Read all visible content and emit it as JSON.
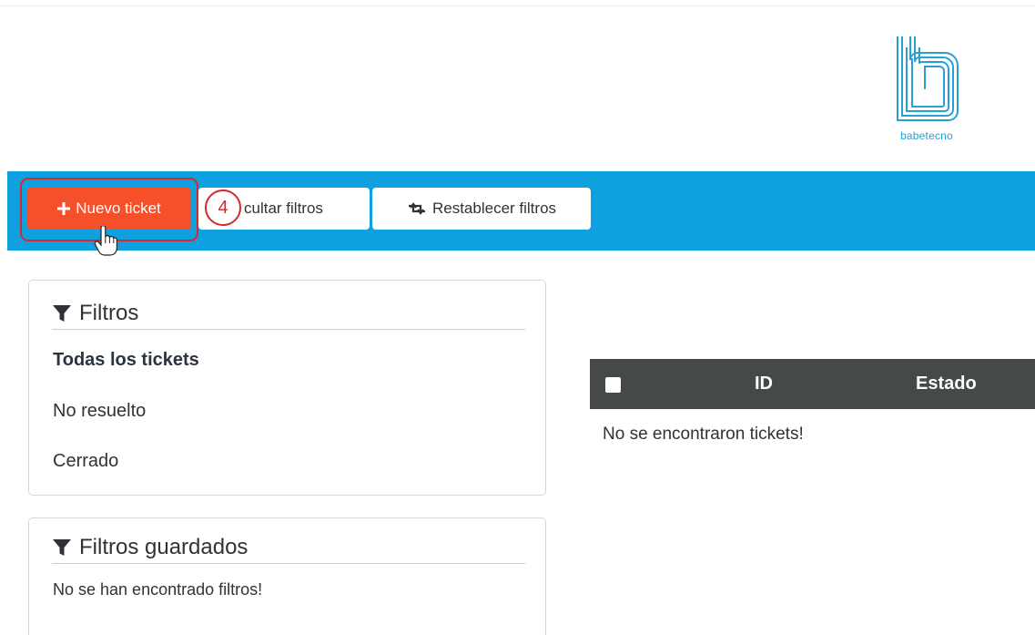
{
  "logo": {
    "text": "babetecno",
    "icon": "babetecno-logo"
  },
  "toolbar": {
    "new_ticket_label": "Nuevo ticket",
    "new_ticket_icon": "plus-icon",
    "hide_filters_label": "cultar filtros",
    "reset_filters_label": "Restablecer filtros",
    "reset_icon": "retweet-icon"
  },
  "annotation": {
    "step": "4",
    "color": "#d6292c"
  },
  "filters": {
    "title": "Filtros",
    "items": [
      {
        "label": "Todas los tickets",
        "active": true
      },
      {
        "label": "No resuelto",
        "active": false
      },
      {
        "label": "Cerrado",
        "active": false
      }
    ]
  },
  "saved_filters": {
    "title": "Filtros guardados",
    "empty_text": "No se han encontrado filtros!"
  },
  "tickets_table": {
    "columns": [
      "ID",
      "Estado"
    ],
    "empty_text": "No se encontraron tickets!"
  },
  "colors": {
    "toolbar_bg": "#0ea0df",
    "new_button_bg": "#f5502a",
    "table_header_bg": "#454948",
    "logo": "#2a9fd6"
  }
}
